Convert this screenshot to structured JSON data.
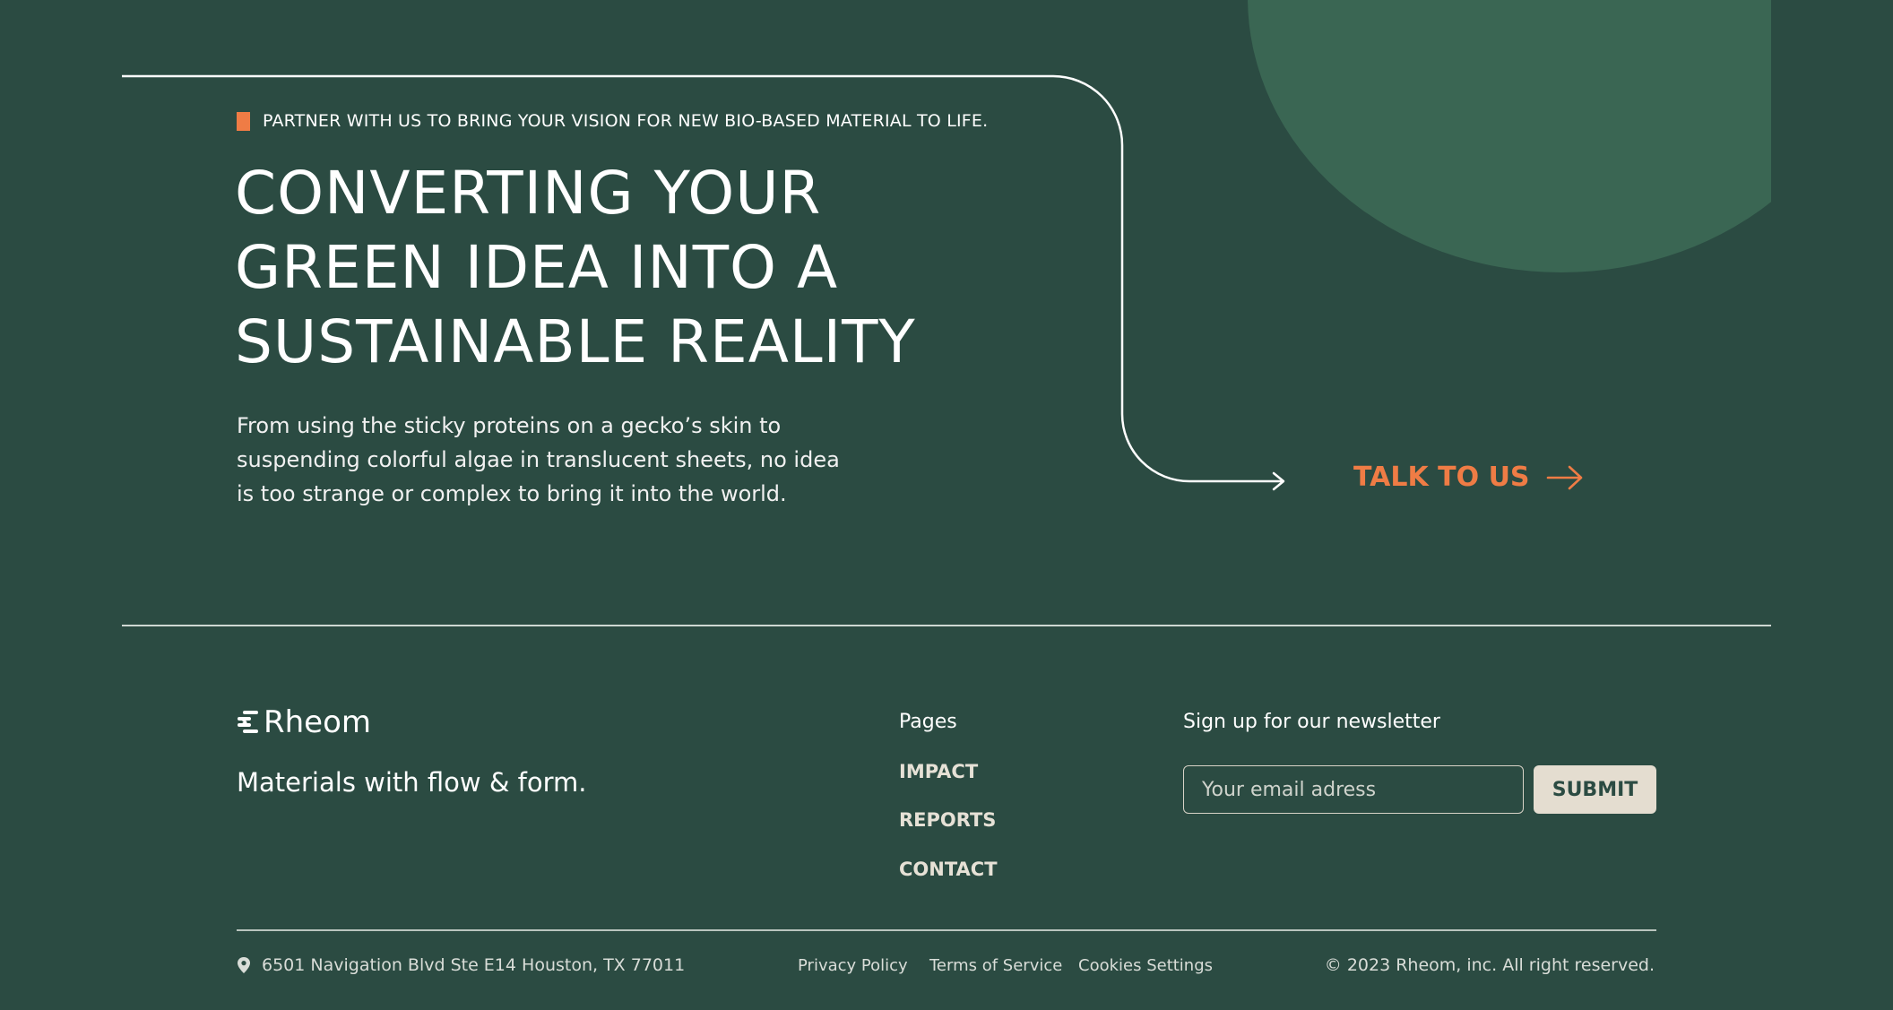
{
  "hero": {
    "eyebrow": "PARTNER WITH US TO BRING YOUR VISION FOR NEW BIO-BASED MATERIAL TO LIFE.",
    "headline_lines": [
      "CONVERTING YOUR",
      "GREEN IDEA INTO A",
      "SUSTAINABLE REALITY"
    ],
    "intro_lines": [
      "From using the sticky proteins on a gecko’s skin to",
      "suspending colorful algae in translucent sheets, no idea",
      "is too strange or complex to bring it into the world."
    ],
    "cta_label": "TALK TO US"
  },
  "footer": {
    "brand_name": "Rheom",
    "tagline": "Materials with flow & form.",
    "pages_title": "Pages",
    "nav": [
      "IMPACT",
      "REPORTS",
      "CONTACT"
    ],
    "newsletter_title": "Sign up for our newsletter",
    "email_placeholder": "Your email adress",
    "submit_label": "SUBMIT",
    "address": "6501 Navigation Blvd Ste E14 Houston, TX 77011",
    "legal_links": [
      "Privacy Policy",
      "Terms of Service",
      "Cookies Settings"
    ],
    "copyright": "© 2023 Rheom, inc. All right reserved."
  },
  "colors": {
    "background": "#2b4b42",
    "circle": "#3a6653",
    "accent": "#ef7c45",
    "button_bg": "#e4ddd0"
  },
  "icons": {
    "cta": "arrow-right-icon",
    "address": "map-pin-icon",
    "logo": "rheom-logo-mark"
  }
}
